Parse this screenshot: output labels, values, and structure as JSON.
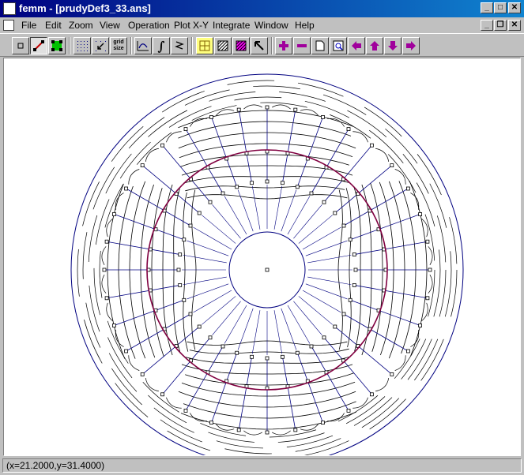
{
  "window": {
    "title": "femm - [prudyDef3_33.ans]",
    "caption_buttons": {
      "minimize": "_",
      "maximize": "□",
      "close": "✕"
    },
    "doc_buttons": {
      "minimize": "_",
      "restore": "❐",
      "close": "✕"
    }
  },
  "menu": [
    {
      "key": "file",
      "label": "File"
    },
    {
      "key": "edit",
      "label": "Edit"
    },
    {
      "key": "zoom",
      "label": "Zoom"
    },
    {
      "key": "view",
      "label": "View"
    },
    {
      "key": "operation",
      "label": "Operation"
    },
    {
      "key": "plotxy",
      "label": "Plot X-Y"
    },
    {
      "key": "integrate",
      "label": "Integrate"
    },
    {
      "key": "window",
      "label": "Window"
    },
    {
      "key": "help",
      "label": "Help"
    }
  ],
  "toolbar": {
    "grid_size_label": "grid size",
    "integral_glyph": "∫",
    "buttons": [
      "point-mode-icon",
      "segment-mode-icon",
      "block-mode-icon",
      "show-grid-icon",
      "snap-grid-icon",
      "grid-size-icon",
      "contour-plot-icon",
      "integral-icon",
      "stress-tensor-icon",
      "select-region-icon",
      "hatch-icon",
      "density-plot-icon",
      "select-arrow-icon",
      "zoom-in-icon",
      "zoom-out-icon",
      "zoom-natural-icon",
      "zoom-window-icon",
      "pan-left-icon",
      "pan-up-icon",
      "pan-down-icon",
      "pan-right-icon"
    ]
  },
  "colors": {
    "title_active": "#000080",
    "geometry": "#000080",
    "flux_lines": "#000000",
    "airgap": "#800040",
    "node": "#000000"
  },
  "status": {
    "coordinates": "(x=21.2000,y=31.4000)"
  }
}
